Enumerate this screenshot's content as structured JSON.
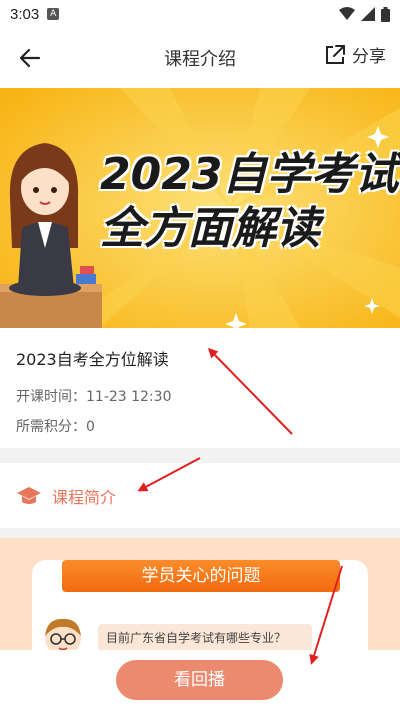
{
  "status_bar": {
    "time": "3:03",
    "notification_badge": "A"
  },
  "header": {
    "title": "课程介绍",
    "share_label": "分享"
  },
  "banner": {
    "line1": "2023自学考试",
    "line2": "全方面解读"
  },
  "course": {
    "name": "2023自考全方位解读",
    "start_time_label": "开课时间：11-23 12:30",
    "points_label": "所需积分：0"
  },
  "intro": {
    "label": "课程简介"
  },
  "qa": {
    "banner_title": "学员关心的问题",
    "question": "目前广东省自学考试有哪些专业？"
  },
  "bottom": {
    "replay_label": "看回播"
  },
  "colors": {
    "accent": "#e8765a",
    "button": "#ec8a70",
    "banner_bg": "#fbc21a",
    "annotation_arrow": "#e02020"
  }
}
